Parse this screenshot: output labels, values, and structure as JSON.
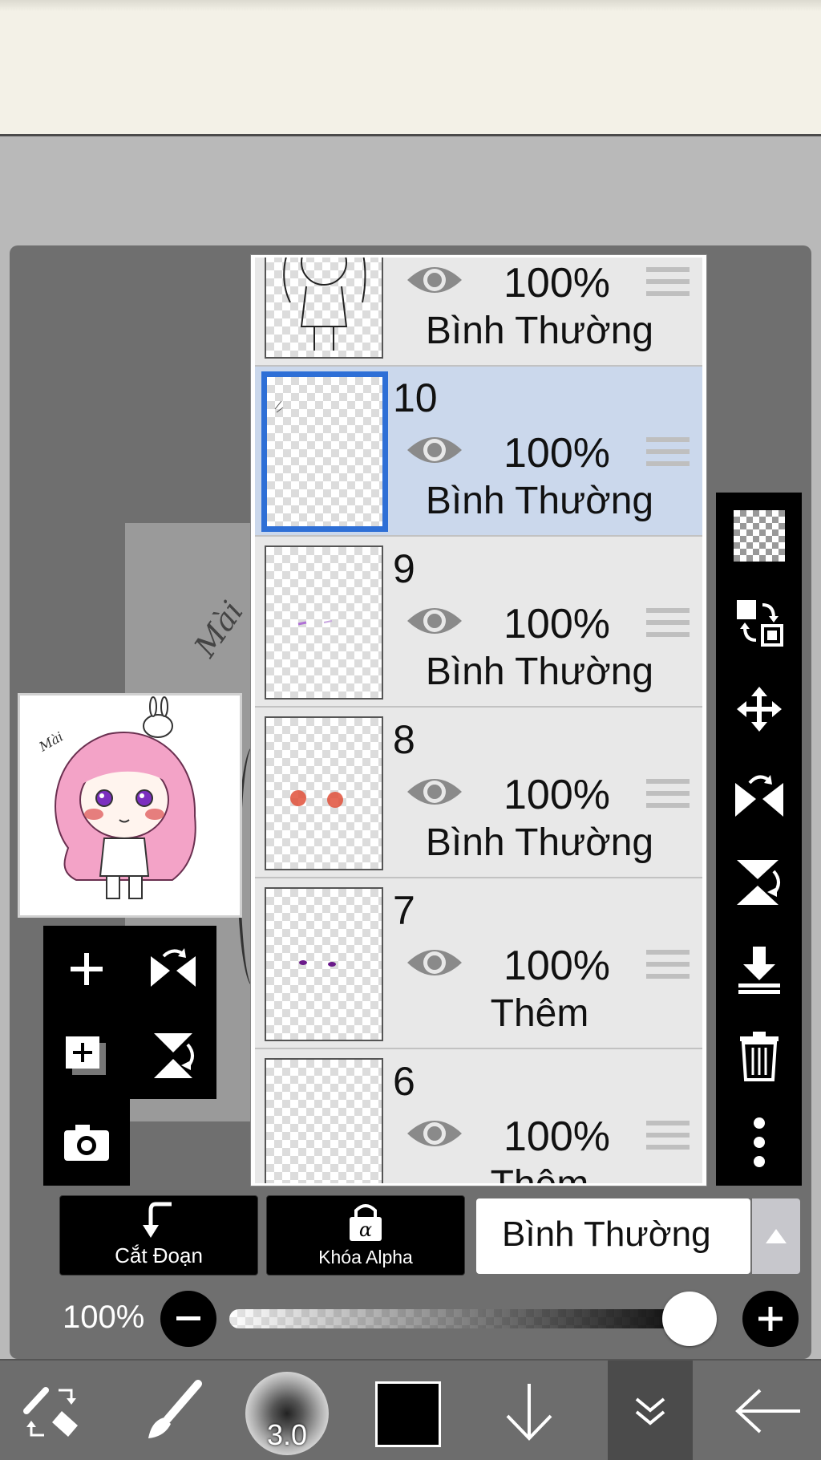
{
  "layers_panel": {
    "layers": [
      {
        "number": "",
        "opacity": "100%",
        "blend_mode": "Bình Thường",
        "selected": false
      },
      {
        "number": "10",
        "opacity": "100%",
        "blend_mode": "Bình Thường",
        "selected": true
      },
      {
        "number": "9",
        "opacity": "100%",
        "blend_mode": "Bình Thường",
        "selected": false
      },
      {
        "number": "8",
        "opacity": "100%",
        "blend_mode": "Bình Thường",
        "selected": false
      },
      {
        "number": "7",
        "opacity": "100%",
        "blend_mode": "Thêm",
        "selected": false
      },
      {
        "number": "6",
        "opacity": "100%",
        "blend_mode": "Thêm",
        "selected": false
      }
    ]
  },
  "canvas": {
    "signature_text": "Mài"
  },
  "bottom_controls": {
    "clipping_label": "Cắt Đoạn",
    "alpha_lock_label": "Khóa Alpha",
    "blend_mode_value": "Bình Thường",
    "opacity_label": "100%",
    "opacity_value": 1.0
  },
  "toolbar": {
    "brush_size": "3.0",
    "current_color": "#000000"
  },
  "colors": {
    "selection_accent": "#2e6fd6",
    "selected_row_bg": "#cbd8ec"
  }
}
